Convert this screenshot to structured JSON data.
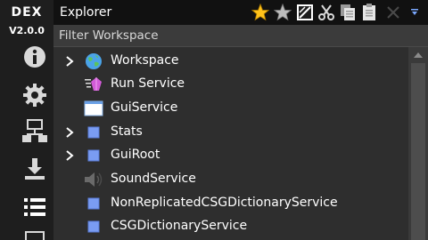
{
  "app": {
    "name": "DEX",
    "version": "V2.0.0"
  },
  "sidebar": {
    "icons": [
      "info-icon",
      "gear-icon",
      "network-icon",
      "download-icon",
      "list-icon",
      "partial-icon"
    ]
  },
  "explorer": {
    "title": "Explorer",
    "toolbar_icons": [
      "star-gold-icon",
      "star-gray-icon",
      "select-icon",
      "cut-icon",
      "copy-icon",
      "paste-icon",
      "close-icon",
      "dropdown-arrow-icon"
    ]
  },
  "filter": {
    "placeholder": "Filter Workspace",
    "value": ""
  },
  "tree": {
    "items": [
      {
        "label": "Workspace",
        "icon": "globe-icon",
        "expandable": true
      },
      {
        "label": "Run Service",
        "icon": "run-service-icon",
        "expandable": false
      },
      {
        "label": "GuiService",
        "icon": "window-icon",
        "expandable": false
      },
      {
        "label": "Stats",
        "icon": "blue-square-icon",
        "expandable": true
      },
      {
        "label": "GuiRoot",
        "icon": "blue-square-icon",
        "expandable": true
      },
      {
        "label": "SoundService",
        "icon": "speaker-icon",
        "expandable": false
      },
      {
        "label": "NonReplicatedCSGDictionaryService",
        "icon": "blue-square-icon",
        "expandable": false
      },
      {
        "label": "CSGDictionaryService",
        "icon": "blue-square-icon",
        "expandable": false
      }
    ]
  },
  "colors": {
    "title_bar": "#111111",
    "panel": "#2e2e2e",
    "sidebar": "#1e1e1e",
    "filter_bar": "#3b3b3b",
    "text": "#ffffff"
  }
}
